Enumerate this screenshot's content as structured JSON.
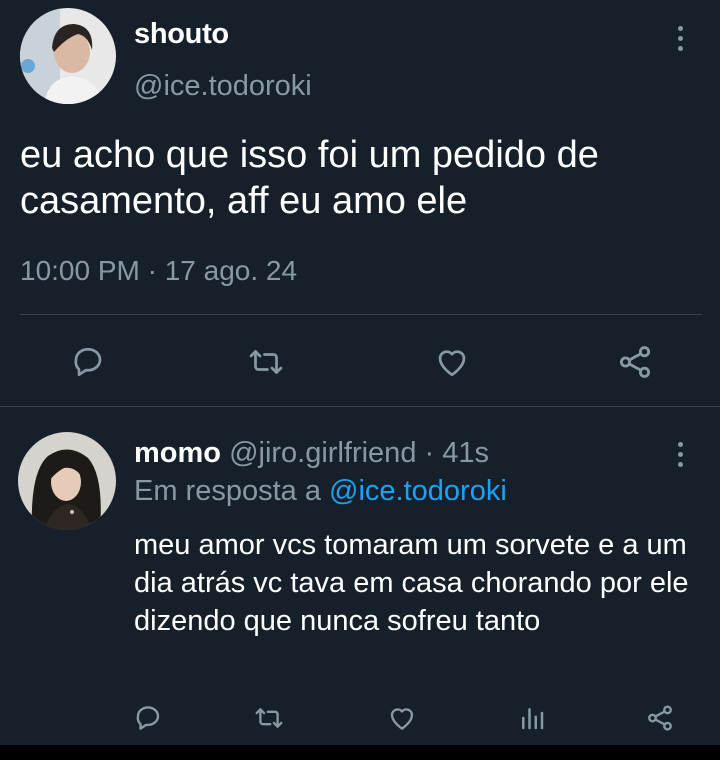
{
  "tweet": {
    "display_name": "shouto",
    "handle": "@ice.todoroki",
    "text": "eu acho que isso foi um pedido de casamento, aff eu amo ele",
    "timestamp": "10:00 PM · 17 ago. 24",
    "actions": [
      "reply-icon",
      "retweet-icon",
      "like-icon",
      "share-icon"
    ]
  },
  "reply": {
    "display_name": "momo",
    "handle": "@jiro.girlfriend",
    "separator": " · ",
    "time": "41s",
    "replying_prefix": "Em resposta a ",
    "replying_to": "@ice.todoroki",
    "text": "meu amor vcs tomaram um sorvete e a um dia atrás vc tava em casa chorando por ele dizendo que nunca sofreu tanto",
    "actions": [
      "reply-icon",
      "retweet-icon",
      "like-icon",
      "stats-icon",
      "share-icon"
    ]
  },
  "colors": {
    "background": "#15202b",
    "text": "#ffffff",
    "secondary": "#8899a6",
    "link": "#1da1f2",
    "divider": "#38444d"
  }
}
